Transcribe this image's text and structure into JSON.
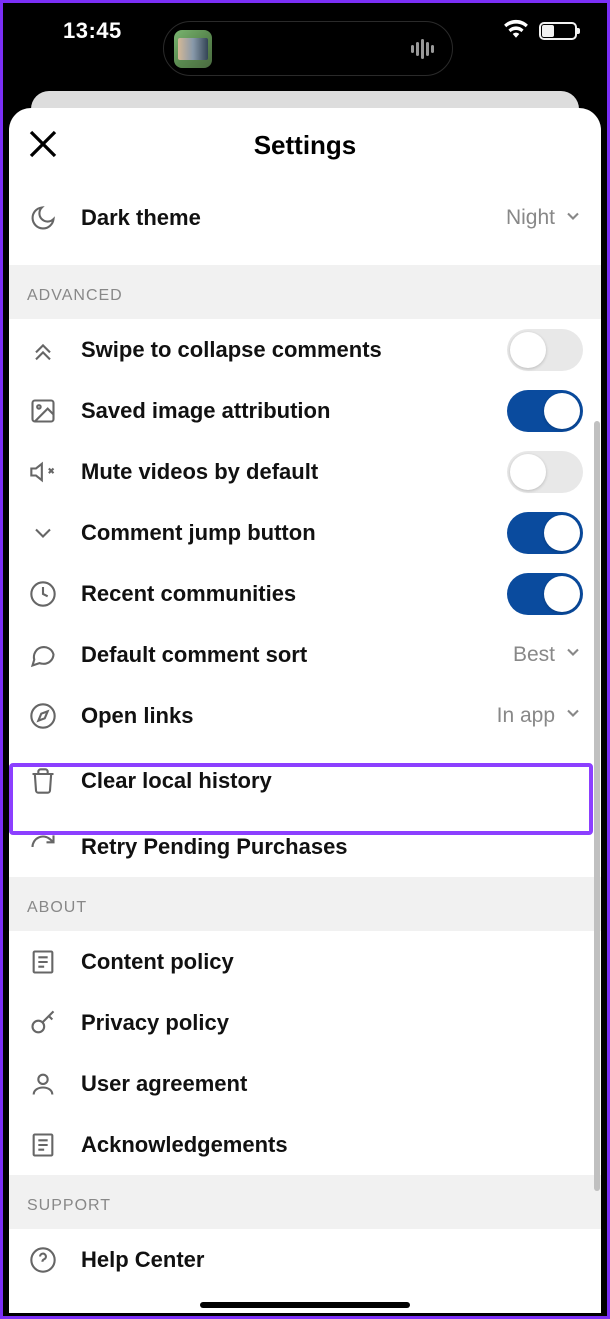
{
  "status": {
    "time": "13:45"
  },
  "header": {
    "title": "Settings"
  },
  "rows": {
    "dark_theme": {
      "label": "Dark theme",
      "value": "Night"
    },
    "swipe_collapse": {
      "label": "Swipe to collapse comments",
      "on": false
    },
    "saved_attr": {
      "label": "Saved image attribution",
      "on": true
    },
    "mute_videos": {
      "label": "Mute videos by default",
      "on": false
    },
    "comment_jump": {
      "label": "Comment jump button",
      "on": true
    },
    "recent_comm": {
      "label": "Recent communities",
      "on": true
    },
    "default_sort": {
      "label": "Default comment sort",
      "value": "Best"
    },
    "open_links": {
      "label": "Open links",
      "value": "In app"
    },
    "clear_history": {
      "label": "Clear local history"
    },
    "retry_purchases": {
      "label": "Retry Pending Purchases"
    },
    "content_policy": {
      "label": "Content policy"
    },
    "privacy_policy": {
      "label": "Privacy policy"
    },
    "user_agreement": {
      "label": "User agreement"
    },
    "acknowledgements": {
      "label": "Acknowledgements"
    },
    "help_center": {
      "label": "Help Center"
    }
  },
  "sections": {
    "advanced": "ADVANCED",
    "about": "ABOUT",
    "support": "SUPPORT"
  }
}
